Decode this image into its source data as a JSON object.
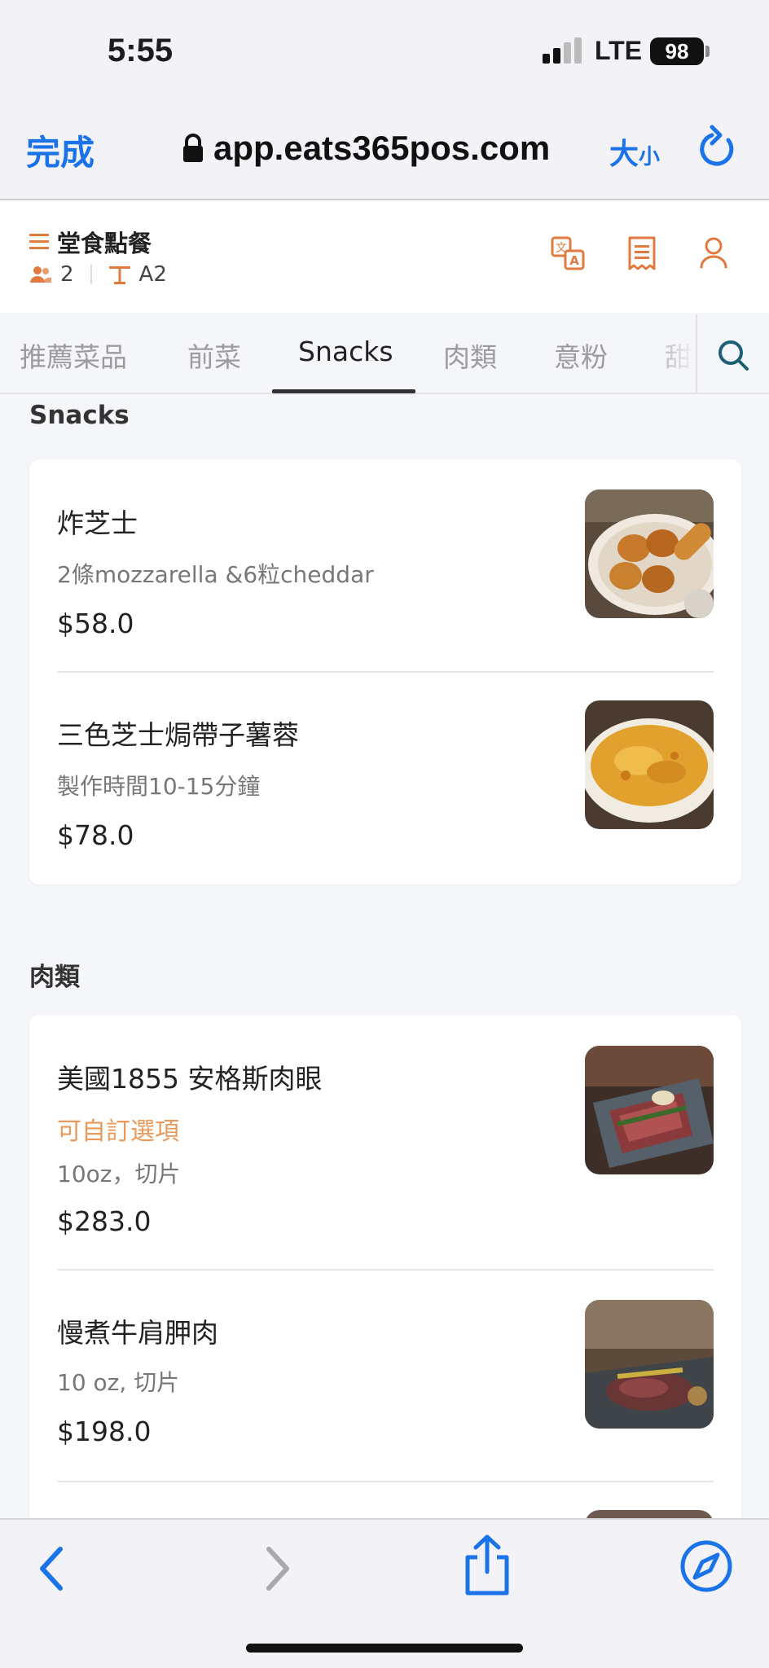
{
  "status_bar": {
    "time": "5:55",
    "carrier": "LTE",
    "battery": "98",
    "icons": [
      "signal-bars-icon",
      "battery-icon"
    ]
  },
  "browser": {
    "done_label": "完成",
    "url": "app.eats365pos.com",
    "text_size_label_big": "大",
    "text_size_label_small": "小",
    "icons": [
      "lock-icon",
      "reload-icon"
    ],
    "accent_color": "#1a73e8"
  },
  "header": {
    "title": "堂食點餐",
    "guests": "2",
    "table": "A2",
    "icons": [
      "menu-icon",
      "people-icon",
      "table-icon",
      "translate-icon",
      "receipt-icon",
      "user-icon"
    ],
    "accent_color": "#e07a3e"
  },
  "tabs": [
    {
      "label": "推薦菜品"
    },
    {
      "label": "前菜"
    },
    {
      "label": "Snacks",
      "active": true
    },
    {
      "label": "肉類"
    },
    {
      "label": "意粉"
    },
    {
      "label": "甜"
    }
  ],
  "sections": [
    {
      "title": "Snacks",
      "items": [
        {
          "name": "炸芝士",
          "desc": "2條mozzarella &6粒cheddar",
          "price": "$58.0",
          "photo": "fried-cheese-photo"
        },
        {
          "name": "三色芝士焗帶子薯蓉",
          "desc": "製作時間10-15分鐘",
          "price": "$78.0",
          "photo": "scallop-mash-photo"
        }
      ]
    },
    {
      "title": "肉類",
      "items": [
        {
          "name": "美國1855 安格斯肉眼",
          "option": "可自訂選項",
          "desc": "10oz，切片",
          "price": "$283.0",
          "photo": "ribeye-photo"
        },
        {
          "name": "慢煮牛肩胛肉",
          "desc": "10 oz, 切片",
          "price": "$198.0",
          "photo": "beef-chuck-photo"
        }
      ]
    }
  ],
  "bottom_bar": {
    "icons": [
      "back-icon",
      "forward-icon",
      "share-icon",
      "compass-icon"
    ]
  }
}
